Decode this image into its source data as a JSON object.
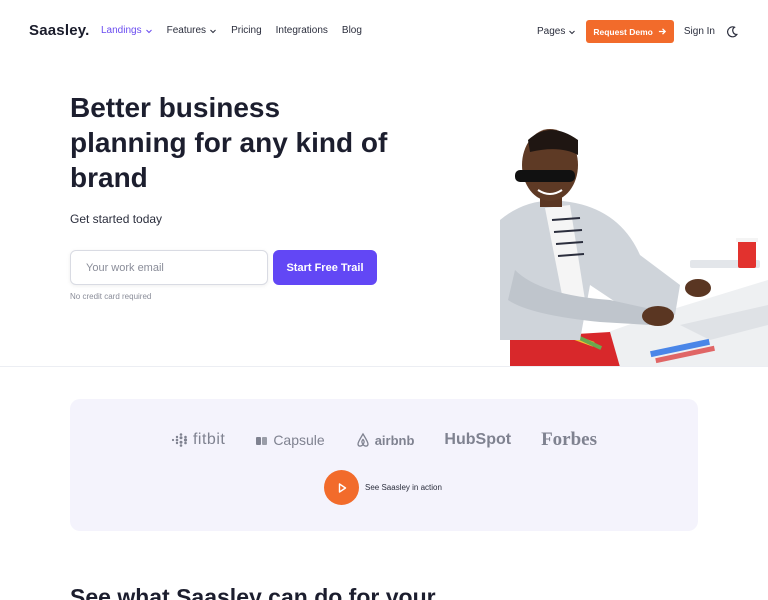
{
  "brand": "Saasley.",
  "nav": {
    "items": [
      {
        "label": "Landings"
      },
      {
        "label": "Features"
      },
      {
        "label": "Pricing"
      },
      {
        "label": "Integrations"
      },
      {
        "label": "Blog"
      }
    ],
    "pages_label": "Pages",
    "demo_label": "Request Demo",
    "signin_label": "Sign In"
  },
  "hero": {
    "title": "Better business planning for any kind of brand",
    "subtitle": "Get started today",
    "email_placeholder": "Your work email",
    "cta_label": "Start Free Trail",
    "note": "No credit card required"
  },
  "logos": {
    "fitbit": "fitbit",
    "capsule": "Capsule",
    "airbnb": "airbnb",
    "hubspot": "HubSpot",
    "forbes": "Forbes"
  },
  "video_label": "See Saasley in action",
  "section_heading": "See what Saasley can do for your",
  "colors": {
    "accent_orange": "#f26b2b",
    "accent_purple": "#6247f5",
    "panel_bg": "#f4f3fc"
  }
}
